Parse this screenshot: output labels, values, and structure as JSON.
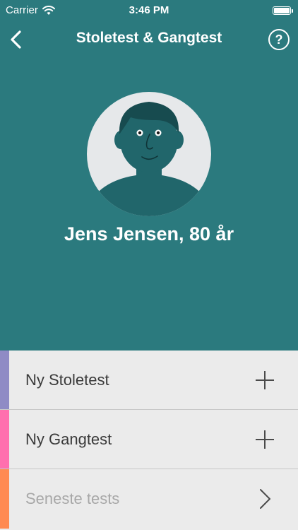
{
  "status_bar": {
    "carrier": "Carrier",
    "time": "3:46 PM",
    "battery_level": 1.0,
    "wifi_icon": "wifi-icon",
    "battery_icon": "battery-icon"
  },
  "nav": {
    "title": "Stoletest & Gangtest",
    "back_icon": "chevron-left-icon",
    "help_label": "?",
    "help_icon": "question-circle-icon"
  },
  "patient": {
    "name": "Jens Jensen, 80 år",
    "avatar_icon": "person-avatar-icon"
  },
  "menu": {
    "items": [
      {
        "label": "Ny Stoletest",
        "icon": "plus-icon",
        "stripe_color": "#8f8bc5",
        "enabled": true
      },
      {
        "label": "Ny Gangtest",
        "icon": "plus-icon",
        "stripe_color": "#ff6fae",
        "enabled": true
      },
      {
        "label": "Seneste tests",
        "icon": "chevron-right-icon",
        "stripe_color": "#ff8a52",
        "enabled": false
      }
    ]
  },
  "colors": {
    "background": "#2b7a7e",
    "avatar_circle": "#e6e8ea",
    "avatar_body": "#21666b",
    "avatar_hair": "#174b4f",
    "menu_background": "#ebebeb"
  }
}
